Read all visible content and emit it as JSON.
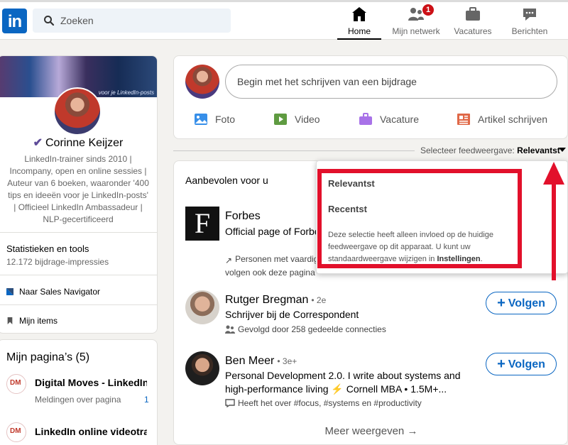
{
  "nav": {
    "logo": "in",
    "search_placeholder": "Zoeken",
    "items": [
      {
        "label": "Home",
        "icon": "home-icon"
      },
      {
        "label": "Mijn netwerk",
        "icon": "network-icon",
        "badge": "1"
      },
      {
        "label": "Vacatures",
        "icon": "briefcase-icon"
      },
      {
        "label": "Berichten",
        "icon": "messaging-icon"
      }
    ]
  },
  "profile": {
    "cover_tag": "voor je LinkedIn-posts",
    "name": "Corinne Keijzer",
    "headline": "LinkedIn-trainer sinds 2010 | Incompany, open en online sessies | Auteur van 6 boeken, waaronder '400 tips en ideeën voor je LinkedIn-posts' | Officieel LinkedIn Ambassadeur | NLP-gecertificeerd",
    "stats_title": "Statistieken en tools",
    "stats_value": "12.172 bijdrage-impressies",
    "sales_link": "Naar Sales Navigator",
    "items_link": "Mijn items"
  },
  "pages": {
    "title": "Mijn pagina’s (5)",
    "items": [
      {
        "name": "Digital Moves - LinkedIn",
        "sub": "Meldingen over pagina",
        "count": "1"
      },
      {
        "name": "LinkedIn online videotraining",
        "sub": "",
        "count": ""
      }
    ]
  },
  "post": {
    "placeholder": "Begin met het schrijven van een bijdrage",
    "actions": [
      "Foto",
      "Video",
      "Vacature",
      "Artikel schrijven"
    ]
  },
  "feed_sort": {
    "label": "Selecteer feedweergave:",
    "value": "Relevantst"
  },
  "dropdown": {
    "options": [
      "Relevantst",
      "Recentst"
    ],
    "note": "Deze selectie heeft alleen invloed op de huidige feedweergave op dit apparaat. U kunt uw standaardweergave wijzigen in",
    "note_link": "Instellingen",
    "note_end": "."
  },
  "recommend": {
    "title": "Aanbevolen voor u",
    "items": [
      {
        "name": "Forbes",
        "degree": "",
        "desc": "Official page of Forbes entrepreneurial succe",
        "meta": "Personen met vaardig volgen ook deze pagina"
      },
      {
        "name": "Rutger Bregman",
        "degree": "• 2e",
        "desc": "Schrijver bij de Correspondent",
        "meta": "Gevolgd door 258 gedeelde connecties"
      },
      {
        "name": "Ben Meer",
        "degree": "• 3e+",
        "desc": "Personal Development 2.0. I write about systems and high-performance living ⚡ Cornell MBA • 1.5M+...",
        "meta": "Heeft het over #focus, #systems en #productivity"
      }
    ],
    "follow_label": "Volgen",
    "more": "Meer weergeven →"
  },
  "colors": {
    "brand": "#0a66c2",
    "annotation": "#e2102b"
  }
}
